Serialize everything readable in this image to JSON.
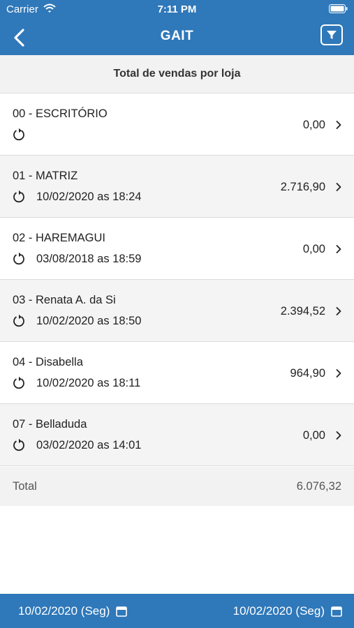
{
  "status_bar": {
    "carrier": "Carrier",
    "time": "7:11 PM"
  },
  "nav": {
    "title": "GAIT"
  },
  "section": {
    "title": "Total de vendas por loja"
  },
  "stores": [
    {
      "name": "00 - ESCRITÓRIO",
      "last_sync": "",
      "value": "0,00"
    },
    {
      "name": "01 - MATRIZ",
      "last_sync": "10/02/2020 as 18:24",
      "value": "2.716,90"
    },
    {
      "name": "02 - HAREMAGUI",
      "last_sync": "03/08/2018 as 18:59",
      "value": "0,00"
    },
    {
      "name": "03 - Renata A. da Si",
      "last_sync": "10/02/2020 as 18:50",
      "value": "2.394,52"
    },
    {
      "name": "04 - Disabella",
      "last_sync": "10/02/2020 as 18:11",
      "value": "964,90"
    },
    {
      "name": "07 - Belladuda",
      "last_sync": "03/02/2020 as 14:01",
      "value": "0,00"
    }
  ],
  "total": {
    "label": "Total",
    "value": "6.076,32"
  },
  "date_range": {
    "start": "10/02/2020 (Seg)",
    "end": "10/02/2020 (Seg)"
  },
  "colors": {
    "brand": "#2f78b9",
    "header_bg": "#f2f2f2",
    "row_alt_bg": "#f4f4f4"
  },
  "icons": [
    "back-icon",
    "filter-icon",
    "sync-icon",
    "chevron-right-icon",
    "calendar-icon",
    "wifi-icon",
    "battery-icon"
  ]
}
